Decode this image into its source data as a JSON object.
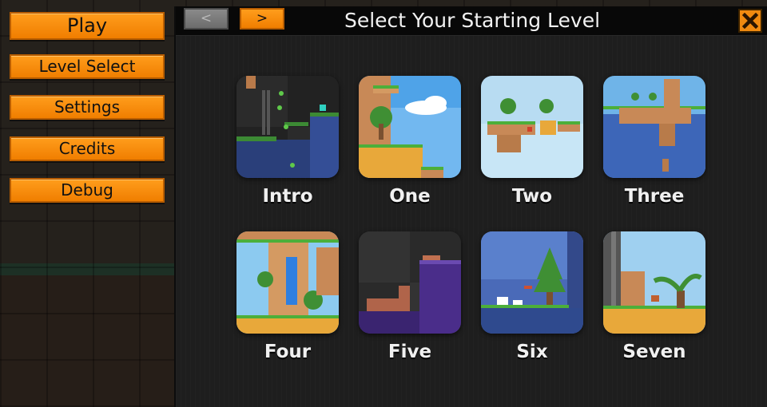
{
  "menu": {
    "items": [
      {
        "label": "Play"
      },
      {
        "label": "Level Select"
      },
      {
        "label": "Settings"
      },
      {
        "label": "Credits"
      },
      {
        "label": "Debug"
      }
    ]
  },
  "dialog": {
    "title": "Select Your Starting Level",
    "prev_label": "<",
    "next_label": ">",
    "close_icon": "close-x-icon"
  },
  "levels": [
    {
      "label": "Intro"
    },
    {
      "label": "One"
    },
    {
      "label": "Two"
    },
    {
      "label": "Three"
    },
    {
      "label": "Four"
    },
    {
      "label": "Five"
    },
    {
      "label": "Six"
    },
    {
      "label": "Seven"
    }
  ],
  "colors": {
    "accent_orange": "#f07e00",
    "dialog_bg": "#1e1e1e",
    "title_bar": "#080808",
    "disabled_gray": "#7a7a7a"
  }
}
